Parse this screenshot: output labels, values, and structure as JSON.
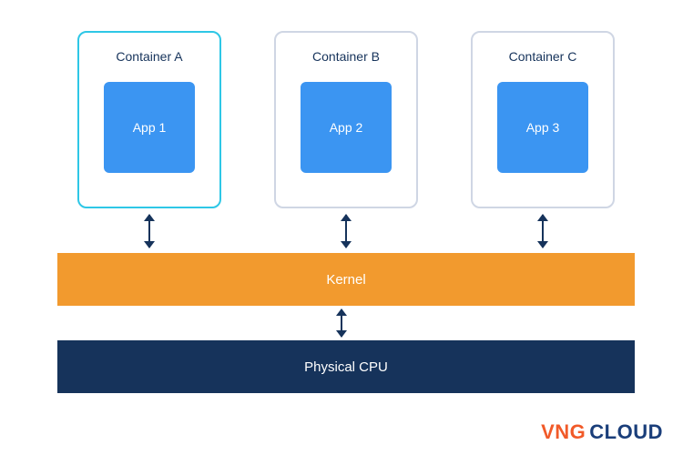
{
  "containers": [
    {
      "title": "Container A",
      "app": "App 1",
      "highlight": true
    },
    {
      "title": "Container B",
      "app": "App 2",
      "highlight": false
    },
    {
      "title": "Container C",
      "app": "App 3",
      "highlight": false
    }
  ],
  "kernel_label": "Kernel",
  "cpu_label": "Physical CPU",
  "logo": {
    "brand_prefix": "VNG",
    "brand_suffix": "CLOUD"
  },
  "colors": {
    "app_box": "#3b95f2",
    "kernel": "#f29a2e",
    "cpu": "#16335b",
    "highlight_border": "#2ec7e6",
    "default_border": "#cfd6e4",
    "logo_prefix": "#f15a29",
    "logo_suffix": "#1a3e7a"
  }
}
